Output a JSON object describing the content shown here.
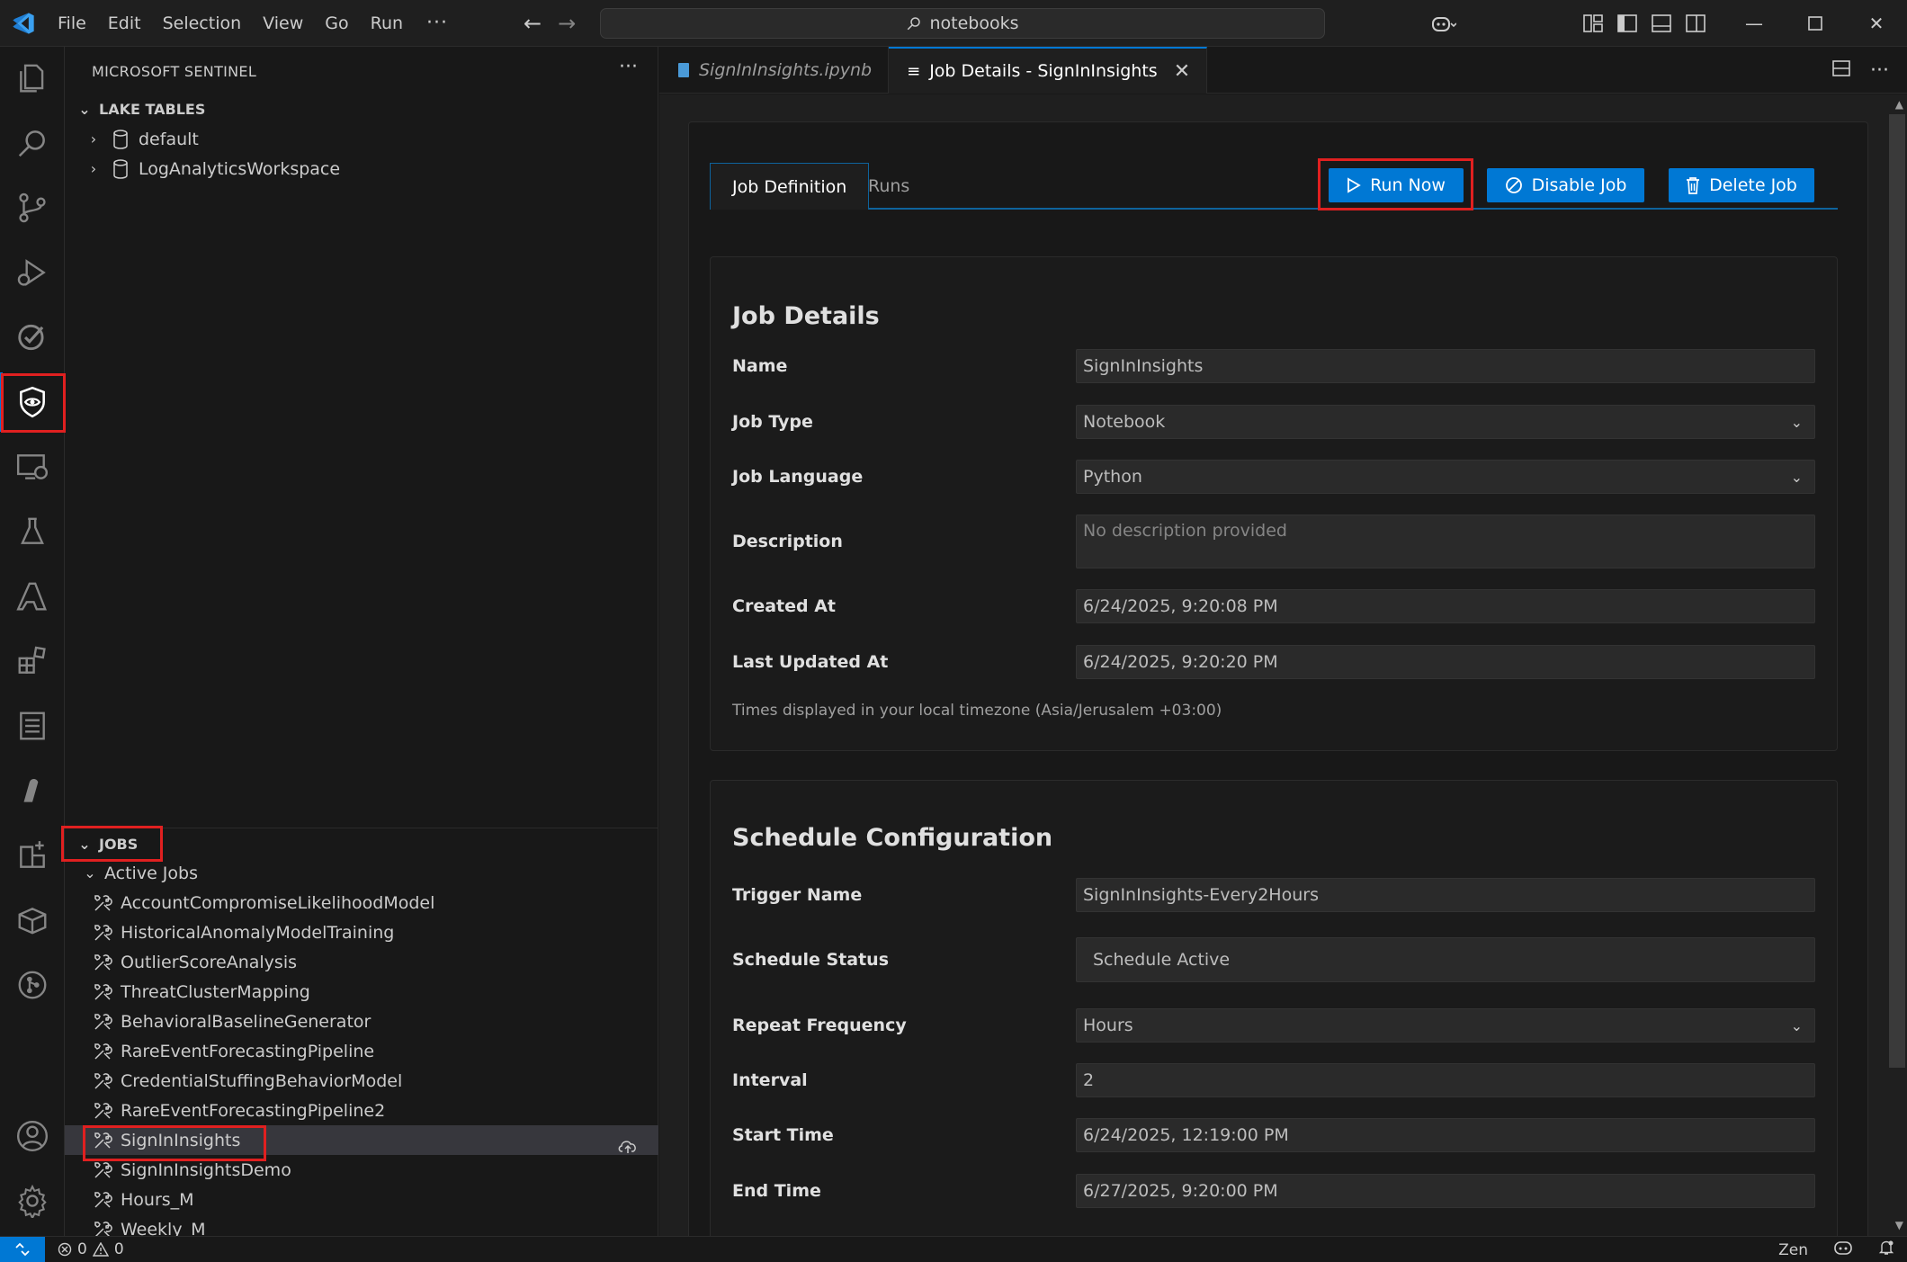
{
  "titlebar": {
    "menu": [
      "File",
      "Edit",
      "Selection",
      "View",
      "Go",
      "Run"
    ],
    "more": "···",
    "search_text": "notebooks"
  },
  "sidebar": {
    "header": "MICROSOFT SENTINEL",
    "more": "···",
    "lake_tables": {
      "title": "LAKE TABLES",
      "items": [
        "default",
        "LogAnalyticsWorkspace"
      ]
    },
    "jobs": {
      "title": "JOBS",
      "group": "Active Jobs",
      "items": [
        "AccountCompromiseLikelihoodModel",
        "HistoricalAnomalyModelTraining",
        "OutlierScoreAnalysis",
        "ThreatClusterMapping",
        "BehavioralBaselineGenerator",
        "RareEventForecastingPipeline",
        "CredentialStuffingBehaviorModel",
        "RareEventForecastingPipeline2",
        "SignInInsights",
        "SignInInsightsDemo",
        "Hours_M",
        "Weekly_M"
      ],
      "selected": "SignInInsights"
    }
  },
  "tabs": [
    {
      "label": "SignInInsights.ipynb",
      "active": false
    },
    {
      "label": "Job Details - SignInInsights",
      "active": true
    }
  ],
  "job_view": {
    "subtabs": [
      "Job Definition",
      "Runs"
    ],
    "actions": {
      "run_now": "Run Now",
      "disable_job": "Disable Job",
      "delete_job": "Delete Job"
    },
    "job_details": {
      "title": "Job Details",
      "fields": {
        "name_label": "Name",
        "name_value": "SignInInsights",
        "type_label": "Job Type",
        "type_value": "Notebook",
        "language_label": "Job Language",
        "language_value": "Python",
        "description_label": "Description",
        "description_placeholder": "No description provided",
        "created_label": "Created At",
        "created_value": "6/24/2025, 9:20:08 PM",
        "updated_label": "Last Updated At",
        "updated_value": "6/24/2025, 9:20:20 PM"
      },
      "timezone_note": "Times displayed in your local timezone (Asia/Jerusalem +03:00)"
    },
    "schedule": {
      "title": "Schedule Configuration",
      "fields": {
        "trigger_label": "Trigger Name",
        "trigger_value": "SignInInsights-Every2Hours",
        "status_label": "Schedule Status",
        "status_value": "Schedule Active",
        "frequency_label": "Repeat Frequency",
        "frequency_value": "Hours",
        "interval_label": "Interval",
        "interval_value": "2",
        "start_label": "Start Time",
        "start_value": "6/24/2025, 12:19:00 PM",
        "end_label": "End Time",
        "end_value": "6/27/2025, 9:20:00 PM"
      }
    }
  },
  "statusbar": {
    "errors": "0",
    "warnings": "0",
    "zen": "Zen"
  },
  "colors": {
    "accent": "#0078d4",
    "highlight": "#e02020",
    "background": "#181818"
  }
}
